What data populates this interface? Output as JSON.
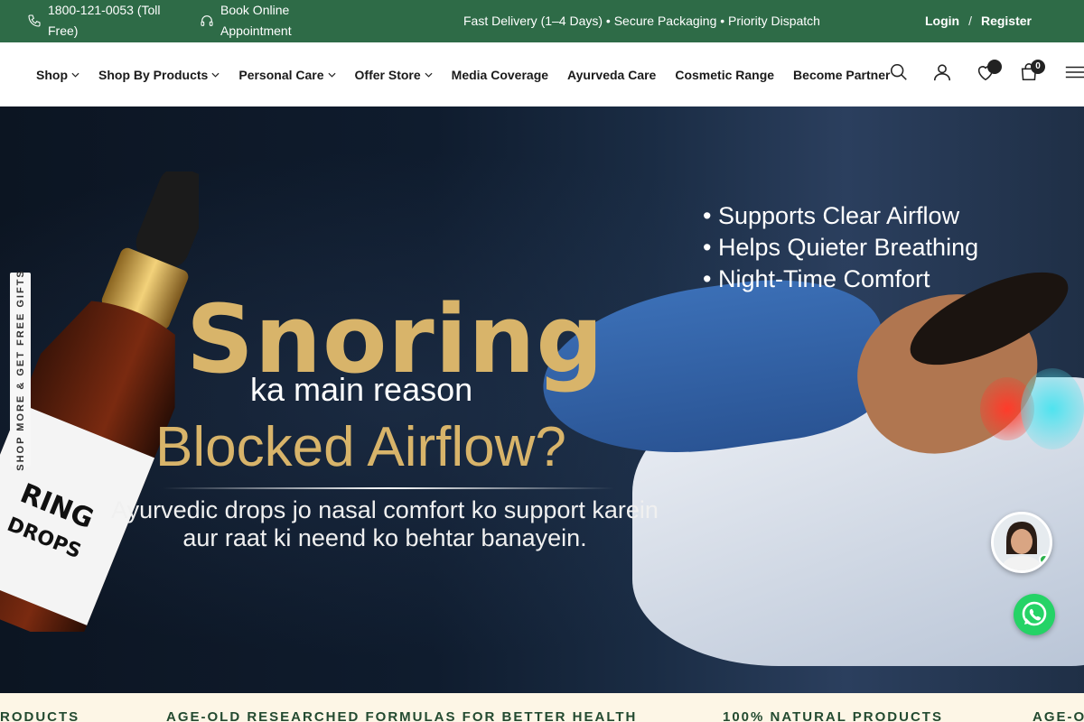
{
  "topbar": {
    "phone": "1800-121-0053 (Toll Free)",
    "appointment": "Book Online Appointment",
    "promo": "Fast Delivery (1–4 Days) • Secure Packaging • Priority Dispatch",
    "login": "Login",
    "separator": "/",
    "register": "Register"
  },
  "nav": {
    "items": [
      {
        "label": "Shop",
        "dropdown": true
      },
      {
        "label": "Shop By Products",
        "dropdown": true
      },
      {
        "label": "Personal Care",
        "dropdown": true
      },
      {
        "label": "Offer Store",
        "dropdown": true
      },
      {
        "label": "Media Coverage",
        "dropdown": false
      },
      {
        "label": "Ayurveda Care",
        "dropdown": false
      },
      {
        "label": "Cosmetic Range",
        "dropdown": false
      },
      {
        "label": "Become Partner",
        "dropdown": false
      }
    ],
    "cart_count": "0",
    "icons": [
      "search-icon",
      "user-icon",
      "wishlist-icon",
      "cart-icon",
      "menu-icon"
    ]
  },
  "hero": {
    "headline": "Snoring",
    "subline": "ka main reason",
    "question": "Blocked Airflow?",
    "description_line1": "Ayurvedic drops jo nasal comfort ko support karein",
    "description_line2": "aur raat ki neend ko behtar banayein.",
    "bullets": [
      "• Supports Clear Airflow",
      "• Helps Quieter Breathing",
      "• Night-Time Comfort"
    ],
    "bottle_label": "RING DROPS"
  },
  "side_tab": "SHOP MORE & GET FREE GIFTS",
  "strip": {
    "items": [
      "RODUCTS",
      "AGE-OLD RESEARCHED FORMULAS FOR BETTER HEALTH",
      "100% NATURAL PRODUCTS",
      "AGE-O"
    ]
  },
  "colors": {
    "topbar": "#2e6b47",
    "gold": "#d8b46a",
    "strip_bg": "#fdf6e6",
    "strip_text": "#234a30"
  }
}
